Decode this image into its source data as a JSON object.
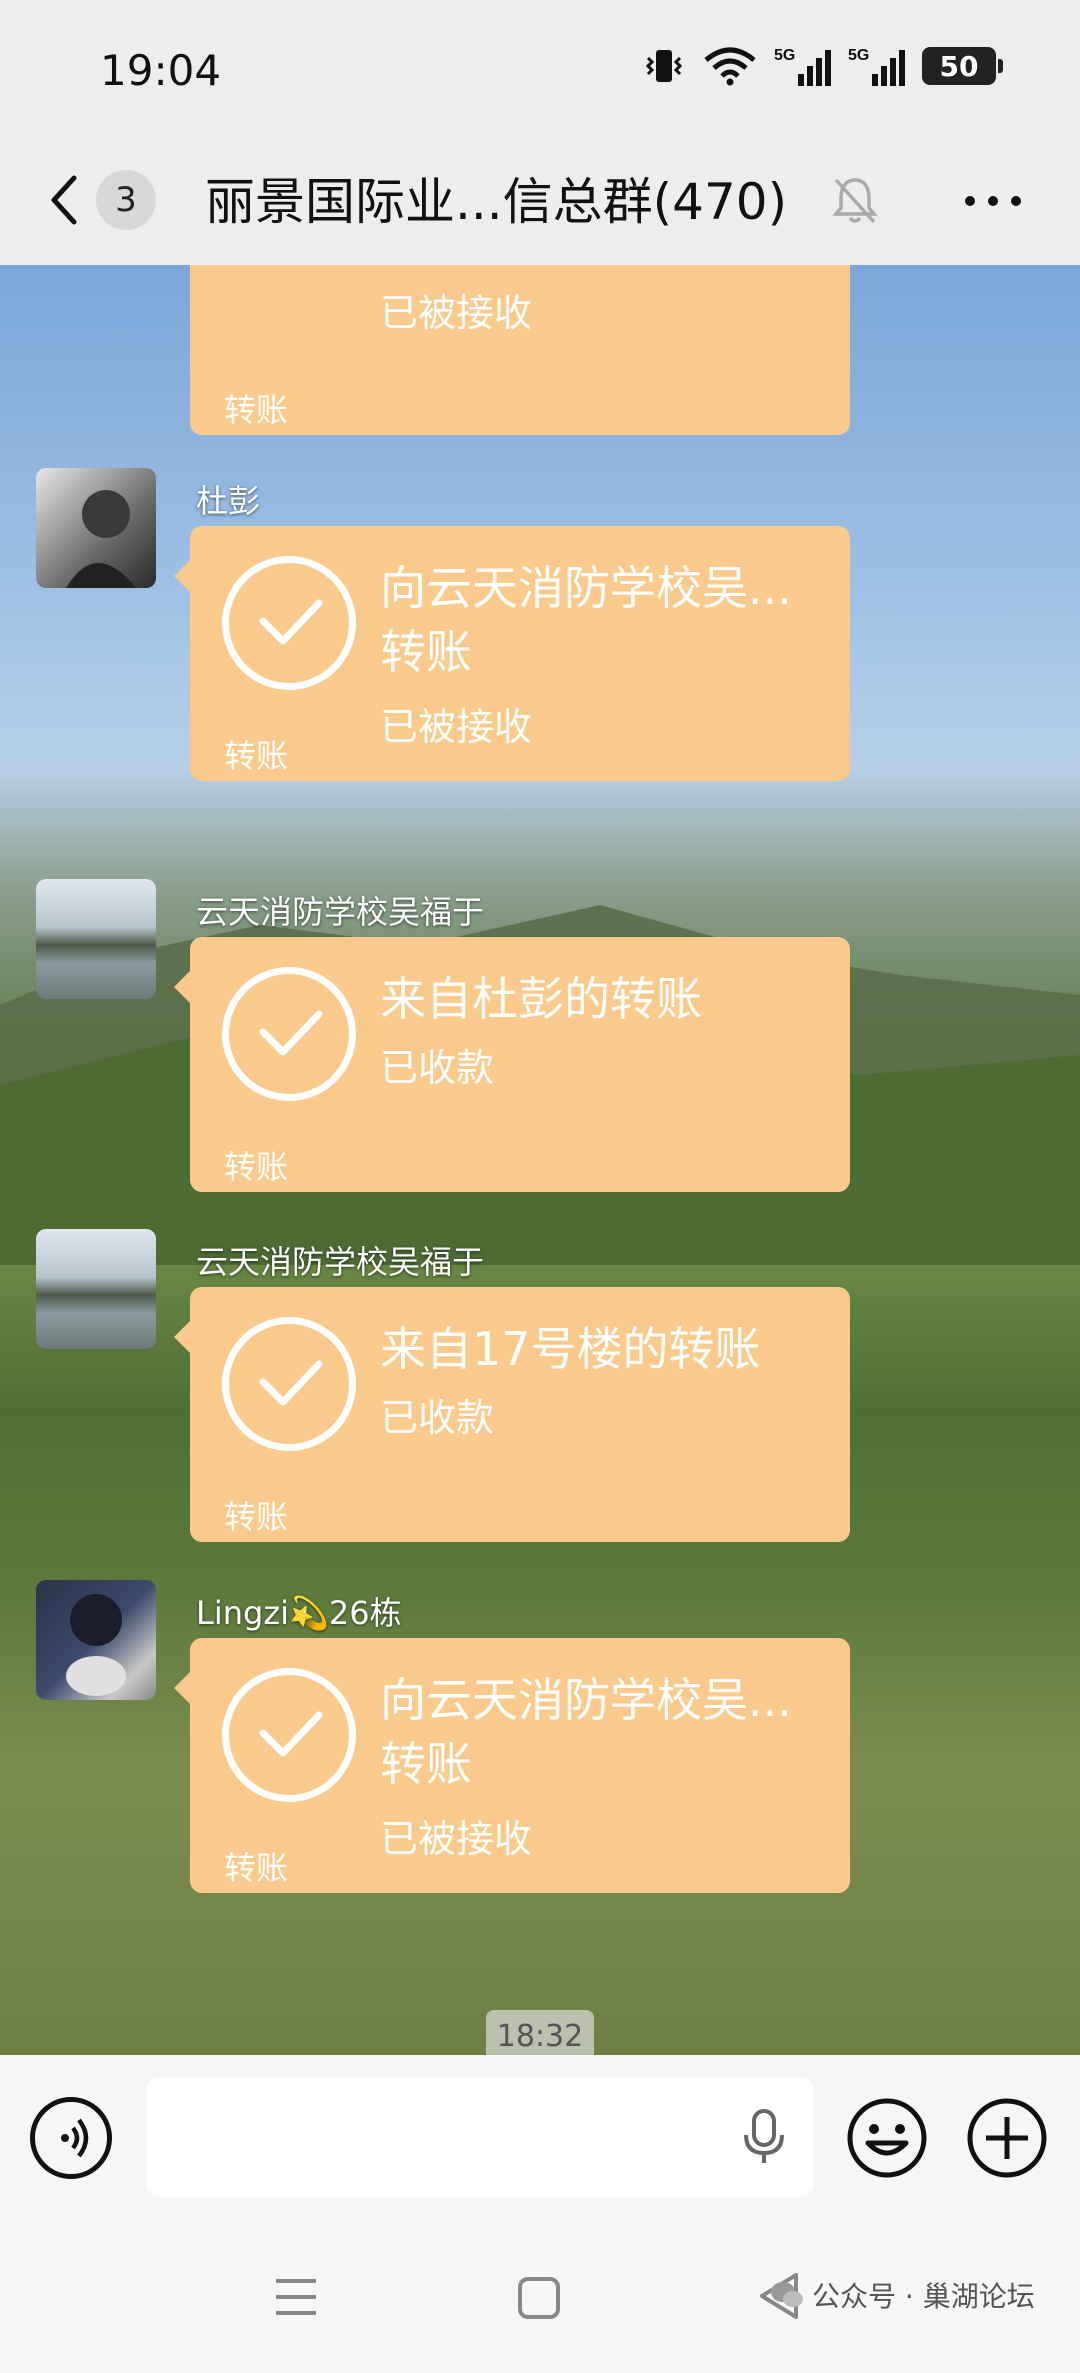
{
  "status_bar": {
    "time": "19:04",
    "battery": "50",
    "network_label_1": "5G",
    "network_label_2": "5G"
  },
  "header": {
    "unread_count": "3",
    "title": "丽景国际业...信总群(470)"
  },
  "messages": [
    {
      "sender": "",
      "title": "",
      "status": "已被接收",
      "label": "转账"
    },
    {
      "sender": "杜彭",
      "title": "向云天消防学校吴...转账",
      "status": "已被接收",
      "label": "转账"
    },
    {
      "sender": "云天消防学校吴福于",
      "title": "来自杜彭的转账",
      "status": "已收款",
      "label": "转账"
    },
    {
      "sender": "云天消防学校吴福于",
      "title": "来自17号楼的转账",
      "status": "已收款",
      "label": "转账"
    },
    {
      "sender": "Lingzi💫26栋",
      "title": "向云天消防学校吴...转账",
      "status": "已被接收",
      "label": "转账"
    }
  ],
  "timestamp": "18:32",
  "watermark": "公众号 · 巢湖论坛",
  "colors": {
    "bubble": "#fac98c",
    "background": "#ededed"
  }
}
